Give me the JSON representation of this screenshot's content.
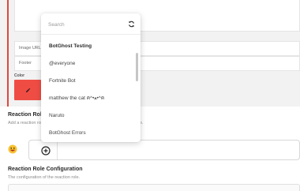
{
  "embed": {
    "image_url_label": "Image URL",
    "footer_label": "Footer",
    "color_label": "Color",
    "color_value": "#ef4d44",
    "accent_color": "#e0473f"
  },
  "reaction_roles": {
    "title": "Reaction Roles",
    "description": "Add a reaction role. Users can react to the message to add or remove.",
    "emoji_icon": "grinning-face-emoji-icon",
    "add_icon": "plus-circle-icon"
  },
  "config": {
    "title": "Reaction Role Configuration",
    "description": "The configuration of the reaction role."
  },
  "dropdown": {
    "search_placeholder": "Search",
    "refresh_icon": "refresh-icon",
    "items": [
      {
        "label": "BotGhost Testing",
        "selected": true
      },
      {
        "label": "@everyone",
        "selected": false
      },
      {
        "label": "Fortnite Bot",
        "selected": false
      },
      {
        "label": "matthew the cat ฅ^•ﻌ•^ฅ",
        "selected": false
      },
      {
        "label": "Naruto",
        "selected": false
      },
      {
        "label": "BotGhost Errors",
        "selected": false
      }
    ]
  }
}
